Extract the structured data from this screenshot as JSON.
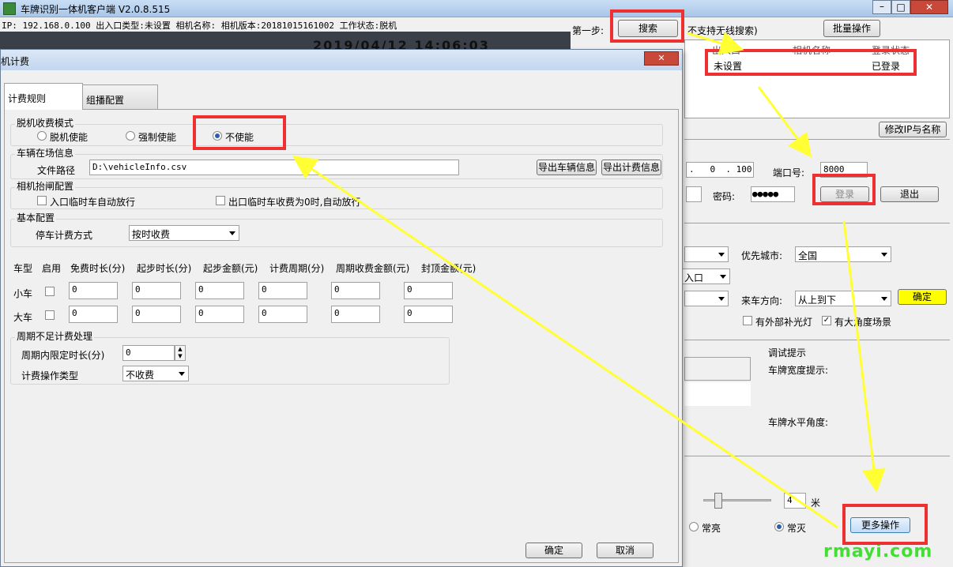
{
  "main_window": {
    "title": "车牌识别一体机客户端 V2.0.8.515",
    "info_bar": "IP: 192.168.0.100 出入口类型:未设置 相机名称:  相机版本:20181015161002 工作状态:脱机",
    "video_overlay": "2019/04/12  14:06:03",
    "step_label": "第一步:",
    "search_button": "搜索",
    "no_wireless": "不支持无线搜索)",
    "batch_button": "批量操作",
    "table_headers": [
      "出入口",
      "相机名称",
      "登录状态"
    ],
    "table_row": {
      "entry": "未设置",
      "status": "已登录"
    },
    "modify_ip_button": "修改IP与名称",
    "ip_tail": [
      ".",
      "0",
      ".",
      "100"
    ],
    "port_label": "端口号:",
    "port_value": "8000",
    "password_label": "密码:",
    "password_value": "●●●●●",
    "login_button": "登录",
    "logout_button": "退出",
    "priority_city_label": "优先城市:",
    "priority_city_value": "全国",
    "entry_select_value": "入口",
    "direction_label": "来车方向:",
    "direction_value": "从上到下",
    "confirm_button": "确定",
    "fill_light_label": "有外部补光灯",
    "big_angle_label": "有大角度场景",
    "debug_title": "调试提示",
    "plate_width_label": "车牌宽度提示:",
    "plate_angle_label": "车牌水平角度:",
    "distance_value": "4",
    "distance_unit": "米",
    "always_on_label": "常亮",
    "always_off_label": "常灭",
    "more_ops_button": "更多操作",
    "watermark": "rmayi.com"
  },
  "dialog": {
    "title": "机计费",
    "tabs": [
      "计费规则",
      "组播配置"
    ],
    "offline_mode_title": "脱机收费模式",
    "offline_options": [
      "脱机使能",
      "强制使能",
      "不使能"
    ],
    "vehicle_info_title": "车辆在场信息",
    "file_path_label": "文件路径",
    "file_path_value": "D:\\vehicleInfo.csv",
    "export_vehicle_button": "导出车辆信息",
    "export_fee_button": "导出计费信息",
    "gate_config_title": "相机抬闸配置",
    "entry_auto_label": "入口临时车自动放行",
    "exit_zero_label": "出口临时车收费为0时,自动放行",
    "basic_config_title": "基本配置",
    "parking_method_label": "停车计费方式",
    "parking_method_value": "按时收费",
    "fee_headers": [
      "车型",
      "启用",
      "免费时长(分)",
      "起步时长(分)",
      "起步金额(元)",
      "计费周期(分)",
      "周期收费金额(元)",
      "封顶金额(元)"
    ],
    "rows": [
      {
        "type": "小车",
        "values": [
          "0",
          "0",
          "0",
          "0",
          "0",
          "0"
        ]
      },
      {
        "type": "大车",
        "values": [
          "0",
          "0",
          "0",
          "0",
          "0",
          "0"
        ]
      }
    ],
    "period_title": "周期不足计费处理",
    "period_limit_label": "周期内限定时长(分)",
    "period_limit_value": "0",
    "fee_op_label": "计费操作类型",
    "fee_op_value": "不收费",
    "ok_button": "确定",
    "cancel_button": "取消"
  }
}
